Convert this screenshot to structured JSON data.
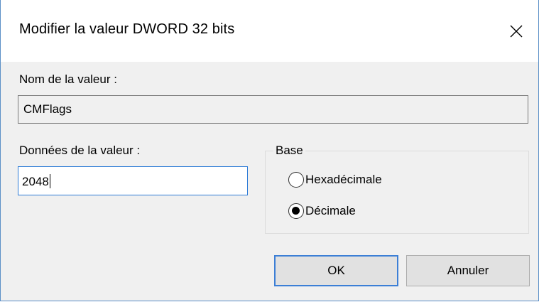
{
  "window": {
    "title": "Modifier la valeur DWORD 32 bits",
    "close_icon": "close-icon"
  },
  "value_name": {
    "label": "Nom de la valeur :",
    "value": "CMFlags"
  },
  "value_data": {
    "label": "Données de la valeur :",
    "value": "2048"
  },
  "base": {
    "legend": "Base",
    "options": [
      {
        "label": "Hexadécimale",
        "selected": false
      },
      {
        "label": "Décimale",
        "selected": true
      }
    ]
  },
  "buttons": {
    "ok_label": "OK",
    "cancel_label": "Annuler"
  },
  "colors": {
    "accent": "#3c7fd6",
    "dialog_background": "#f0f0f0"
  }
}
